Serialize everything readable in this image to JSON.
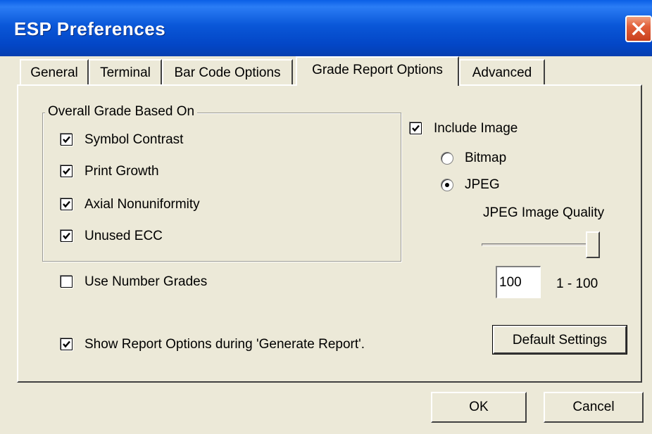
{
  "window": {
    "title": "ESP Preferences"
  },
  "tabs": [
    {
      "label": "General"
    },
    {
      "label": "Terminal"
    },
    {
      "label": "Bar Code Options"
    },
    {
      "label": "Grade Report Options",
      "active": true
    },
    {
      "label": "Advanced"
    }
  ],
  "overall_grade": {
    "label": "Overall Grade Based On",
    "items": [
      {
        "label": "Symbol Contrast",
        "checked": true
      },
      {
        "label": "Print Growth",
        "checked": true
      },
      {
        "label": "Axial Nonuniformity",
        "checked": true
      },
      {
        "label": "Unused ECC",
        "checked": true
      }
    ]
  },
  "use_number_grades": {
    "label": "Use Number Grades",
    "checked": false
  },
  "show_report_options": {
    "label": "Show Report Options during 'Generate Report'.",
    "checked": true
  },
  "include_image": {
    "label": "Include Image",
    "checked": true
  },
  "image_format": {
    "options": [
      {
        "label": "Bitmap",
        "selected": false
      },
      {
        "label": "JPEG",
        "selected": true
      }
    ]
  },
  "jpeg_quality": {
    "label": "JPEG Image Quality",
    "value": "100",
    "range_label": "1 - 100",
    "slider_value": 100
  },
  "buttons": {
    "default_settings": "Default Settings",
    "ok": "OK",
    "cancel": "Cancel"
  },
  "icons": {
    "close": "close-icon",
    "check": "checkmark-icon"
  },
  "colors": {
    "titlebar": "#0a57d8",
    "face": "#ece9d8",
    "close": "#e2603a"
  }
}
